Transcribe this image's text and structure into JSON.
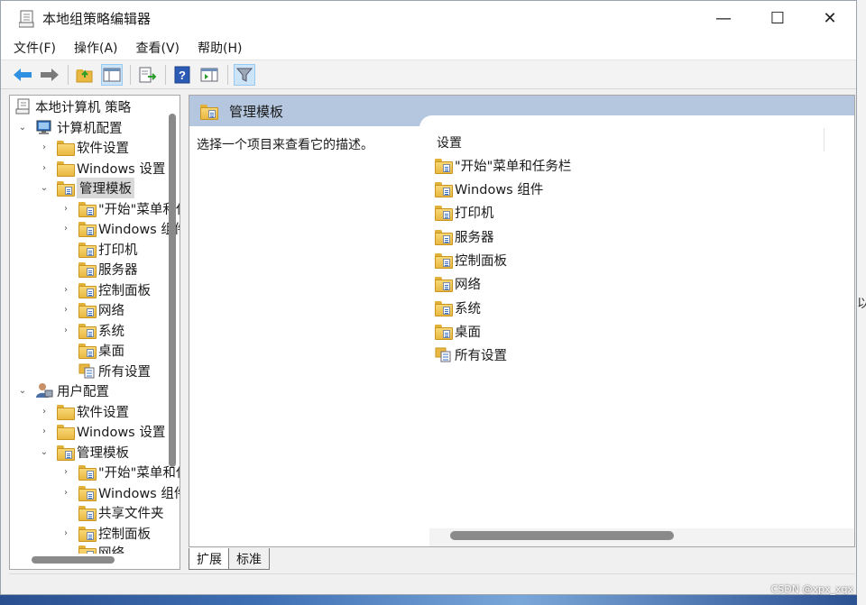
{
  "window": {
    "title": "本地组策略编辑器",
    "minimize_glyph": "—",
    "maximize_glyph": "☐",
    "close_glyph": "✕"
  },
  "menu": [
    "文件(F)",
    "操作(A)",
    "查看(V)",
    "帮助(H)"
  ],
  "toolbar": {
    "icons": [
      "back-arrow-icon",
      "forward-arrow-icon",
      "up-folder-icon",
      "show-hide-tree-icon",
      "export-list-icon",
      "help-icon",
      "properties-pane-icon",
      "filter-icon"
    ]
  },
  "tree": {
    "root": "本地计算机 策略",
    "computer_config": "计算机配置",
    "computer_items": {
      "software": "软件设置",
      "windows": "Windows 设置",
      "admin_templates": "管理模板",
      "start_menu": "\"开始\"菜单和任务栏",
      "windows_components": "Windows 组件",
      "printers": "打印机",
      "server": "服务器",
      "control_panel": "控制面板",
      "network": "网络",
      "system": "系统",
      "desktop": "桌面",
      "all_settings": "所有设置"
    },
    "user_config": "用户配置",
    "user_items": {
      "software": "软件设置",
      "windows": "Windows 设置",
      "admin_templates": "管理模板",
      "start_menu": "\"开始\"菜单和任务栏",
      "windows_components": "Windows 组件",
      "shared_folders": "共享文件夹",
      "control_panel": "控制面板",
      "network": "网络"
    }
  },
  "right_pane": {
    "header": "管理模板",
    "description": "选择一个项目来查看它的描述。",
    "column_header": "设置",
    "items": [
      "\"开始\"菜单和任务栏",
      "Windows 组件",
      "打印机",
      "服务器",
      "控制面板",
      "网络",
      "系统",
      "桌面",
      "所有设置"
    ]
  },
  "tabs": [
    "扩展",
    "标准"
  ],
  "active_tab": "扩展",
  "watermark": "CSDN @xpx_xqx",
  "side_fragment": "以",
  "colors": {
    "header_band": "#b5c7df",
    "folder": "#e9b842",
    "selection": "#d9d9d9"
  }
}
